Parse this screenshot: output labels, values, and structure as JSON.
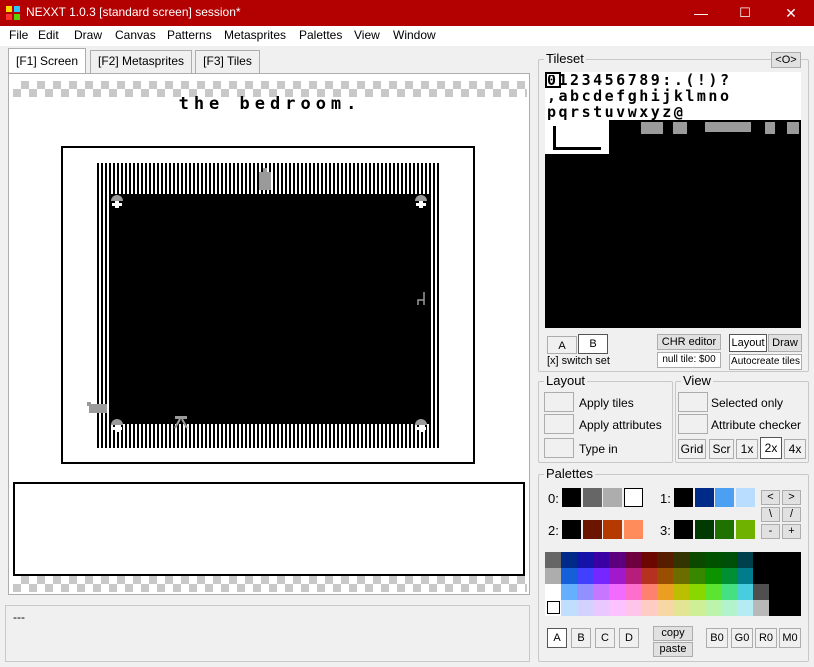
{
  "window": {
    "title": "NEXXT 1.0.3  [standard screen] session*",
    "minimize": "—",
    "maximize": "☐",
    "close": "✕"
  },
  "menu": [
    "File",
    "Edit",
    "Draw",
    "Canvas",
    "Patterns",
    "Metasprites",
    "Palettes",
    "View",
    "Window"
  ],
  "tabs": [
    "[F1] Screen",
    "[F2] Metasprites",
    "[F3] Tiles"
  ],
  "screen": {
    "room_title": "the bedroom."
  },
  "status": {
    "text": "---"
  },
  "tileset": {
    "label": "Tileset",
    "toggle_label": "<O>",
    "row1": "0123456789:.(!)?",
    "row2": ",abcdefghijklmno",
    "row3": "pqrstuvwxyz@",
    "set_a": "A",
    "set_b": "B",
    "switch_set": "[x] switch set",
    "chr_editor": "CHR editor",
    "null_tile": "null tile: $00",
    "layout": "Layout",
    "draw": "Draw",
    "autocreate": "Autocreate tiles"
  },
  "layout_group": {
    "label": "Layout",
    "apply_tiles": "Apply tiles",
    "apply_attributes": "Apply attributes",
    "type_in": "Type in"
  },
  "view_group": {
    "label": "View",
    "selected_only": "Selected only",
    "attribute_checker": "Attribute checker",
    "grid": "Grid",
    "scr": "Scr",
    "x1": "1x",
    "x2": "2x",
    "x4": "4x"
  },
  "palettes": {
    "label": "Palettes",
    "p0": "0:",
    "p1": "1:",
    "p2": "2:",
    "p3": "3:",
    "pal0": [
      "#000000",
      "#666666",
      "#adadad",
      "#ffffff"
    ],
    "pal1": [
      "#000000",
      "#002a88",
      "#4ba0f4",
      "#b8ddff"
    ],
    "pal2": [
      "#000000",
      "#6b1400",
      "#b53a00",
      "#ff8c5a"
    ],
    "pal3": [
      "#000000",
      "#003a00",
      "#207200",
      "#6fb300"
    ],
    "nav_prev": "<",
    "nav_next": ">",
    "nav_back": "\\",
    "nav_fwd": "/",
    "nav_minus": "-",
    "nav_plus": "+",
    "btn_a": "A",
    "btn_b": "B",
    "btn_c": "C",
    "btn_d": "D",
    "copy": "copy",
    "paste": "paste",
    "b0": "B0",
    "g0": "G0",
    "r0": "R0",
    "m0": "M0",
    "nes_colors": [
      [
        "#666666",
        "#002a88",
        "#1412a7",
        "#3b00a4",
        "#5c007e",
        "#6e0040",
        "#6c0700",
        "#561d00",
        "#333500",
        "#0b4800",
        "#005200",
        "#004f08",
        "#00404d",
        "#000000",
        "#000000",
        "#000000"
      ],
      [
        "#adadad",
        "#155fd9",
        "#4240ff",
        "#7527fe",
        "#a01acc",
        "#b71e7b",
        "#b53120",
        "#994e00",
        "#6b6d00",
        "#388700",
        "#0c9300",
        "#008f32",
        "#007c8d",
        "#000000",
        "#000000",
        "#000000"
      ],
      [
        "#ffffff",
        "#64b0ff",
        "#9290ff",
        "#c676ff",
        "#f36aff",
        "#fe6ecc",
        "#fe8170",
        "#ea9e22",
        "#bcbe00",
        "#88d800",
        "#5ce430",
        "#45e082",
        "#48cdde",
        "#4f4f4f",
        "#000000",
        "#000000"
      ],
      [
        "#ffffff",
        "#c0dfff",
        "#d3d2ff",
        "#e8c8ff",
        "#fbc2ff",
        "#fec4ea",
        "#feccc5",
        "#f7d8a5",
        "#e4e594",
        "#cfef96",
        "#bdf4ab",
        "#b3f3cc",
        "#b5ebf2",
        "#b8b8b8",
        "#000000",
        "#000000"
      ]
    ]
  }
}
